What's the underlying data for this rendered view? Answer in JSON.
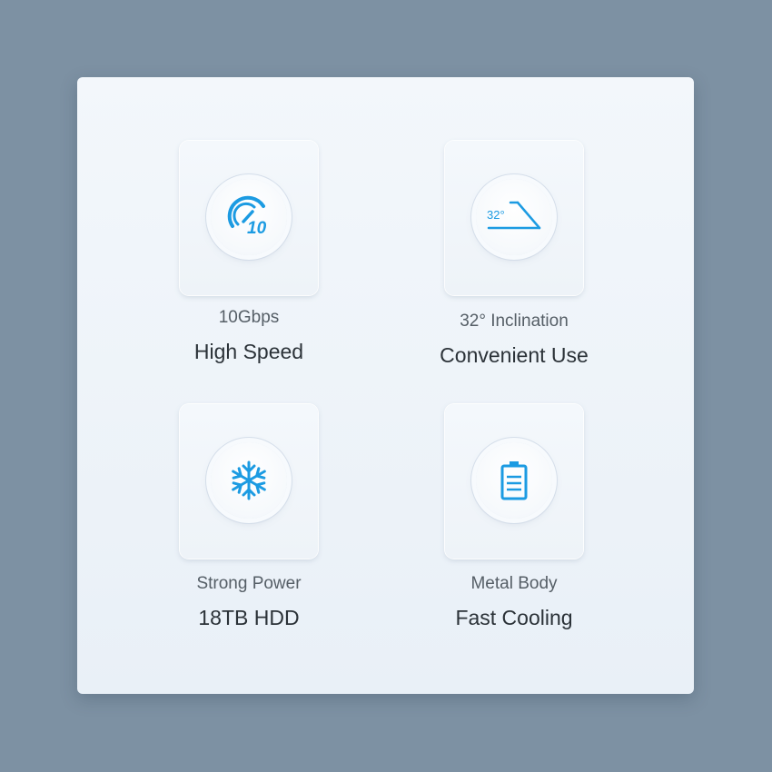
{
  "colors": {
    "background": "#7d91a3",
    "panel": "#eef3f8",
    "icon_accent": "#1c9be2",
    "subtitle_text": "#555e66",
    "title_text": "#2b3238"
  },
  "features": [
    {
      "icon": "speedometer-10-icon",
      "icon_text": "10",
      "subtitle": "10Gbps",
      "title": "High Speed"
    },
    {
      "icon": "inclination-angle-icon",
      "icon_text": "32°",
      "subtitle": "32° Inclination",
      "title": "Convenient Use"
    },
    {
      "icon": "snowflake-icon",
      "subtitle": "Strong Power",
      "title": "18TB HDD"
    },
    {
      "icon": "battery-icon",
      "subtitle": "Metal Body",
      "title": "Fast Cooling"
    }
  ]
}
